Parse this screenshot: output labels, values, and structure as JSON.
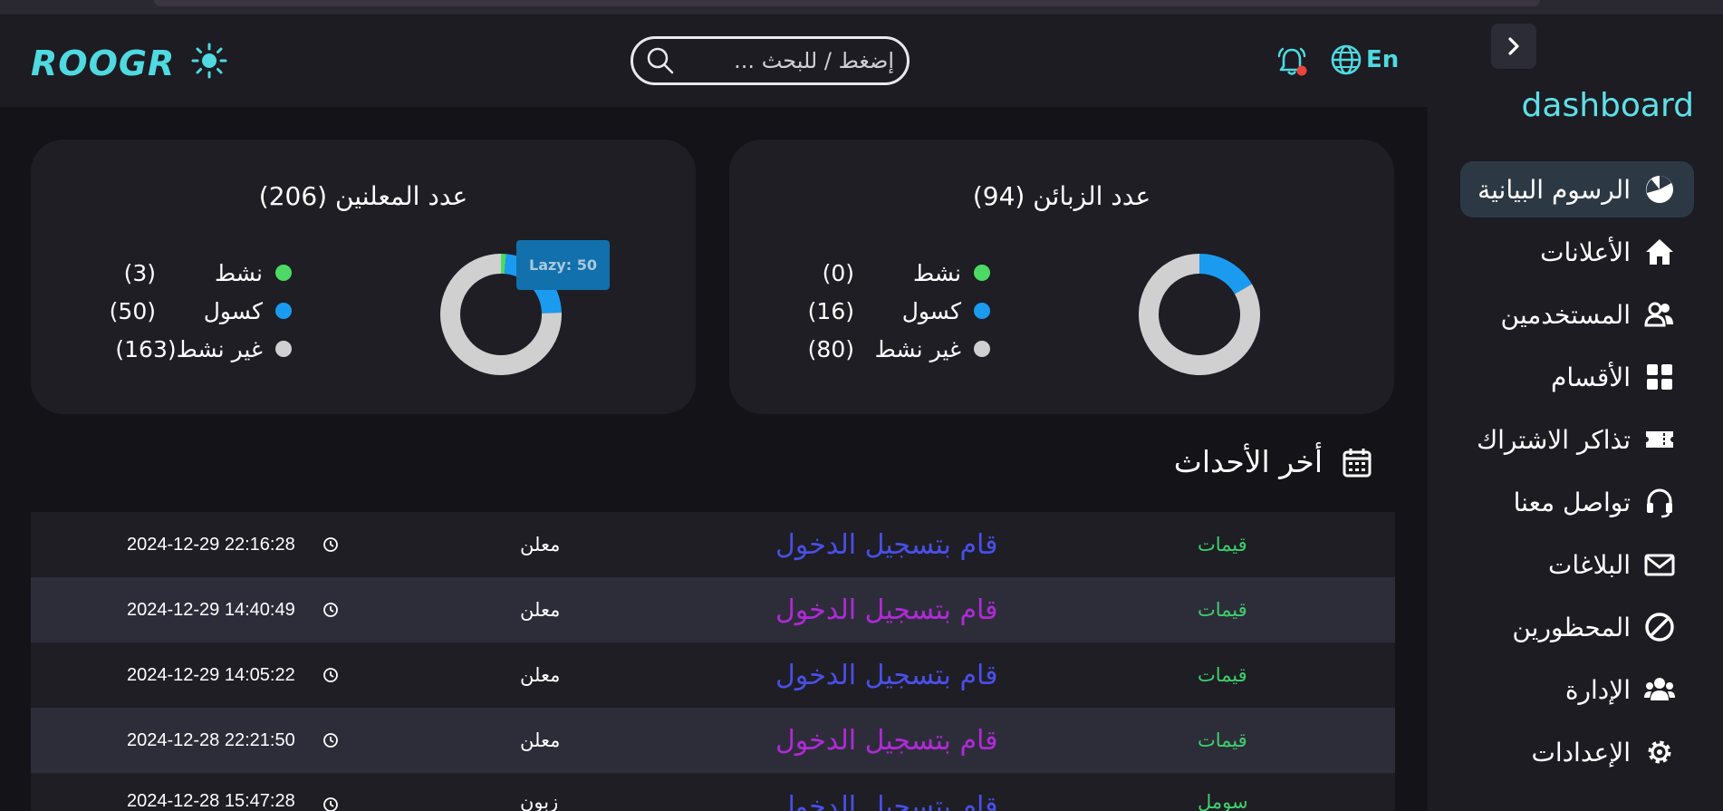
{
  "sidebar": {
    "title": "dashboard",
    "items": [
      {
        "label": "الرسوم البيانية",
        "icon": "pie-chart-icon",
        "active": true
      },
      {
        "label": "الأعلانات",
        "icon": "home-icon",
        "active": false
      },
      {
        "label": "المستخدمين",
        "icon": "users-icon",
        "active": false
      },
      {
        "label": "الأقسام",
        "icon": "grid-icon",
        "active": false
      },
      {
        "label": "تذاكر الاشتراك",
        "icon": "ticket-icon",
        "active": false
      },
      {
        "label": "تواصل معنا",
        "icon": "headset-icon",
        "active": false
      },
      {
        "label": "البلاغات",
        "icon": "envelope-icon",
        "active": false
      },
      {
        "label": "المحظورين",
        "icon": "ban-icon",
        "active": false
      },
      {
        "label": "الإدارة",
        "icon": "admins-icon",
        "active": false
      },
      {
        "label": "الإعدادات",
        "icon": "gear-icon",
        "active": false
      }
    ]
  },
  "header": {
    "logo": "ROOGR",
    "search_placeholder": "إضغط / للبحث ...",
    "lang": "En"
  },
  "cards": {
    "customers": {
      "title": "عدد الزبائن  (94)",
      "legend": [
        {
          "name": "نشط",
          "value": "(0)",
          "color": "#4cd964"
        },
        {
          "name": "كسول",
          "value": "(16)",
          "color": "#1a9bf0"
        },
        {
          "name": "غير نشط",
          "value": "(80)",
          "color": "#d0d0d0"
        }
      ]
    },
    "advertisers": {
      "title": "عدد المعلنين  (206)",
      "legend": [
        {
          "name": "نشط",
          "value": "(3)",
          "color": "#4cd964"
        },
        {
          "name": "كسول",
          "value": "(50)",
          "color": "#1a9bf0"
        },
        {
          "name": "غير نشط",
          "value": "(163)",
          "color": "#d0d0d0"
        }
      ],
      "tooltip": "Lazy: 50"
    }
  },
  "chart_data": [
    {
      "type": "pie",
      "title": "عدد الزبائن  (94)",
      "categories": [
        "نشط",
        "كسول",
        "غير نشط"
      ],
      "values": [
        0,
        16,
        80
      ]
    },
    {
      "type": "pie",
      "title": "عدد المعلنين  (206)",
      "categories": [
        "نشط",
        "كسول",
        "غير نشط"
      ],
      "values": [
        3,
        50,
        163
      ]
    }
  ],
  "events": {
    "title": "أخر الأحداث",
    "rows": [
      {
        "user": "قيمات",
        "action": "قام بتسجيل الدخول",
        "action_color": "#4a4fe8",
        "role": "معلن",
        "time": "2024-12-29 22:16:28"
      },
      {
        "user": "قيمات",
        "action": "قام بتسجيل الدخول",
        "action_color": "#b02ad8",
        "role": "معلن",
        "time": "2024-12-29 14:40:49"
      },
      {
        "user": "قيمات",
        "action": "قام بتسجيل الدخول",
        "action_color": "#4a4fe8",
        "role": "معلن",
        "time": "2024-12-29 14:05:22"
      },
      {
        "user": "قيمات",
        "action": "قام بتسجيل الدخول",
        "action_color": "#b02ad8",
        "role": "معلن",
        "time": "2024-12-28 22:21:50"
      },
      {
        "user": "سومل",
        "action": "قام بتسجيل الدخول",
        "action_color": "#4a4fe8",
        "role": "زبون",
        "time": "2024-12-28 15:47:28"
      }
    ]
  }
}
